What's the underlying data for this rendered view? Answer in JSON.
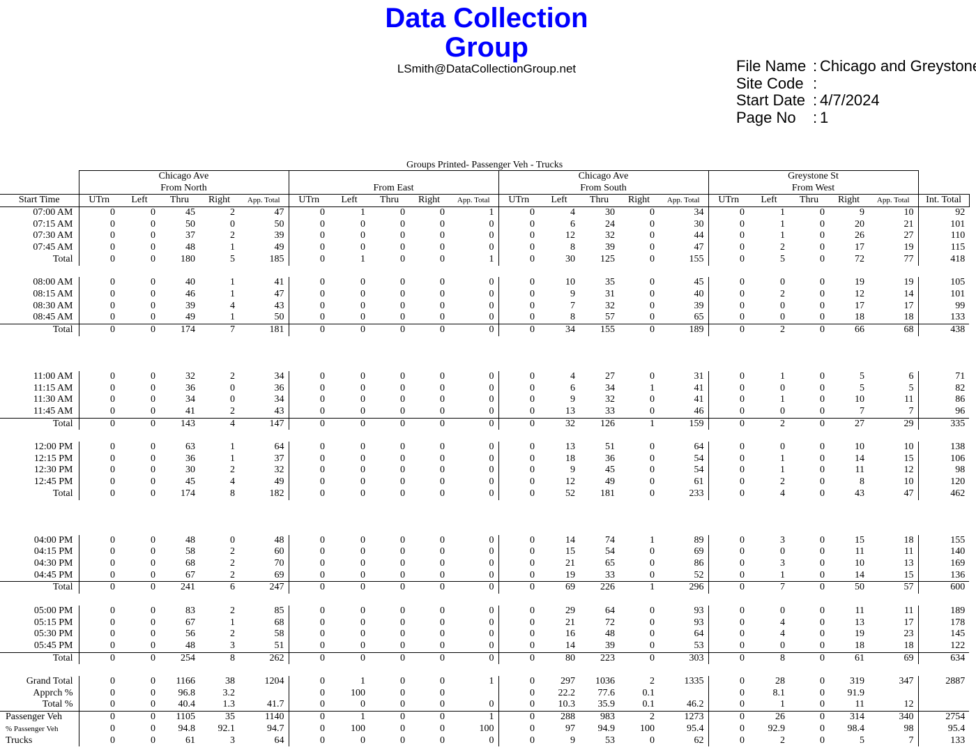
{
  "header": {
    "title": "Data Collection Group",
    "email": "LSmith@DataCollectionGroup.net"
  },
  "meta": [
    {
      "label": "File Name",
      "value": "Chicago and Greystone"
    },
    {
      "label": "Site Code",
      "value": ""
    },
    {
      "label": "Start Date",
      "value": "4/7/2024"
    },
    {
      "label": "Page No",
      "value": "1"
    }
  ],
  "table": {
    "caption": "Groups Printed- Passenger Veh - Trucks",
    "groups": [
      {
        "street": "Chicago Ave",
        "dir": "From North"
      },
      {
        "street": "",
        "dir": "From East"
      },
      {
        "street": "Chicago Ave",
        "dir": "From South"
      },
      {
        "street": "Greystone St",
        "dir": "From West"
      }
    ],
    "columns": [
      "Start Time",
      "UTrn",
      "Left",
      "Thru",
      "Right",
      "App. Total",
      "UTrn",
      "Left",
      "Thru",
      "Right",
      "App. Total",
      "UTrn",
      "Left",
      "Thru",
      "Right",
      "App. Total",
      "UTrn",
      "Left",
      "Thru",
      "Right",
      "App. Total",
      "Int. Total"
    ],
    "rows": [
      {
        "kind": "data",
        "cells": [
          "07:00 AM",
          "0",
          "0",
          "45",
          "2",
          "47",
          "0",
          "1",
          "0",
          "0",
          "1",
          "0",
          "4",
          "30",
          "0",
          "34",
          "0",
          "1",
          "0",
          "9",
          "10",
          "92"
        ]
      },
      {
        "kind": "data",
        "cells": [
          "07:15 AM",
          "0",
          "0",
          "50",
          "0",
          "50",
          "0",
          "0",
          "0",
          "0",
          "0",
          "0",
          "6",
          "24",
          "0",
          "30",
          "0",
          "1",
          "0",
          "20",
          "21",
          "101"
        ]
      },
      {
        "kind": "data",
        "cells": [
          "07:30 AM",
          "0",
          "0",
          "37",
          "2",
          "39",
          "0",
          "0",
          "0",
          "0",
          "0",
          "0",
          "12",
          "32",
          "0",
          "44",
          "0",
          "1",
          "0",
          "26",
          "27",
          "110"
        ]
      },
      {
        "kind": "data",
        "cells": [
          "07:45 AM",
          "0",
          "0",
          "48",
          "1",
          "49",
          "0",
          "0",
          "0",
          "0",
          "0",
          "0",
          "8",
          "39",
          "0",
          "47",
          "0",
          "2",
          "0",
          "17",
          "19",
          "115"
        ]
      },
      {
        "kind": "total",
        "cells": [
          "Total",
          "0",
          "0",
          "180",
          "5",
          "185",
          "0",
          "1",
          "0",
          "0",
          "1",
          "0",
          "30",
          "125",
          "0",
          "155",
          "0",
          "5",
          "0",
          "72",
          "77",
          "418"
        ]
      },
      {
        "kind": "blank"
      },
      {
        "kind": "data",
        "cells": [
          "08:00 AM",
          "0",
          "0",
          "40",
          "1",
          "41",
          "0",
          "0",
          "0",
          "0",
          "0",
          "0",
          "10",
          "35",
          "0",
          "45",
          "0",
          "0",
          "0",
          "19",
          "19",
          "105"
        ]
      },
      {
        "kind": "data",
        "cells": [
          "08:15 AM",
          "0",
          "0",
          "46",
          "1",
          "47",
          "0",
          "0",
          "0",
          "0",
          "0",
          "0",
          "9",
          "31",
          "0",
          "40",
          "0",
          "2",
          "0",
          "12",
          "14",
          "101"
        ]
      },
      {
        "kind": "data",
        "cells": [
          "08:30 AM",
          "0",
          "0",
          "39",
          "4",
          "43",
          "0",
          "0",
          "0",
          "0",
          "0",
          "0",
          "7",
          "32",
          "0",
          "39",
          "0",
          "0",
          "0",
          "17",
          "17",
          "99"
        ]
      },
      {
        "kind": "data",
        "cells": [
          "08:45 AM",
          "0",
          "0",
          "49",
          "1",
          "50",
          "0",
          "0",
          "0",
          "0",
          "0",
          "0",
          "8",
          "57",
          "0",
          "65",
          "0",
          "0",
          "0",
          "18",
          "18",
          "133"
        ]
      },
      {
        "kind": "total",
        "cells": [
          "Total",
          "0",
          "0",
          "174",
          "7",
          "181",
          "0",
          "0",
          "0",
          "0",
          "0",
          "0",
          "34",
          "155",
          "0",
          "189",
          "0",
          "2",
          "0",
          "66",
          "68",
          "438"
        ]
      },
      {
        "kind": "blank"
      },
      {
        "kind": "blank"
      },
      {
        "kind": "blank"
      },
      {
        "kind": "data",
        "cells": [
          "11:00 AM",
          "0",
          "0",
          "32",
          "2",
          "34",
          "0",
          "0",
          "0",
          "0",
          "0",
          "0",
          "4",
          "27",
          "0",
          "31",
          "0",
          "1",
          "0",
          "5",
          "6",
          "71"
        ]
      },
      {
        "kind": "data",
        "cells": [
          "11:15 AM",
          "0",
          "0",
          "36",
          "0",
          "36",
          "0",
          "0",
          "0",
          "0",
          "0",
          "0",
          "6",
          "34",
          "1",
          "41",
          "0",
          "0",
          "0",
          "5",
          "5",
          "82"
        ]
      },
      {
        "kind": "data",
        "cells": [
          "11:30 AM",
          "0",
          "0",
          "34",
          "0",
          "34",
          "0",
          "0",
          "0",
          "0",
          "0",
          "0",
          "9",
          "32",
          "0",
          "41",
          "0",
          "1",
          "0",
          "10",
          "11",
          "86"
        ]
      },
      {
        "kind": "data",
        "cells": [
          "11:45 AM",
          "0",
          "0",
          "41",
          "2",
          "43",
          "0",
          "0",
          "0",
          "0",
          "0",
          "0",
          "13",
          "33",
          "0",
          "46",
          "0",
          "0",
          "0",
          "7",
          "7",
          "96"
        ]
      },
      {
        "kind": "total",
        "cells": [
          "Total",
          "0",
          "0",
          "143",
          "4",
          "147",
          "0",
          "0",
          "0",
          "0",
          "0",
          "0",
          "32",
          "126",
          "1",
          "159",
          "0",
          "2",
          "0",
          "27",
          "29",
          "335"
        ]
      },
      {
        "kind": "blank"
      },
      {
        "kind": "data",
        "cells": [
          "12:00 PM",
          "0",
          "0",
          "63",
          "1",
          "64",
          "0",
          "0",
          "0",
          "0",
          "0",
          "0",
          "13",
          "51",
          "0",
          "64",
          "0",
          "0",
          "0",
          "10",
          "10",
          "138"
        ]
      },
      {
        "kind": "data",
        "cells": [
          "12:15 PM",
          "0",
          "0",
          "36",
          "1",
          "37",
          "0",
          "0",
          "0",
          "0",
          "0",
          "0",
          "18",
          "36",
          "0",
          "54",
          "0",
          "1",
          "0",
          "14",
          "15",
          "106"
        ]
      },
      {
        "kind": "data",
        "cells": [
          "12:30 PM",
          "0",
          "0",
          "30",
          "2",
          "32",
          "0",
          "0",
          "0",
          "0",
          "0",
          "0",
          "9",
          "45",
          "0",
          "54",
          "0",
          "1",
          "0",
          "11",
          "12",
          "98"
        ]
      },
      {
        "kind": "data",
        "cells": [
          "12:45 PM",
          "0",
          "0",
          "45",
          "4",
          "49",
          "0",
          "0",
          "0",
          "0",
          "0",
          "0",
          "12",
          "49",
          "0",
          "61",
          "0",
          "2",
          "0",
          "8",
          "10",
          "120"
        ]
      },
      {
        "kind": "total",
        "cells": [
          "Total",
          "0",
          "0",
          "174",
          "8",
          "182",
          "0",
          "0",
          "0",
          "0",
          "0",
          "0",
          "52",
          "181",
          "0",
          "233",
          "0",
          "4",
          "0",
          "43",
          "47",
          "462"
        ]
      },
      {
        "kind": "blank"
      },
      {
        "kind": "blank"
      },
      {
        "kind": "blank"
      },
      {
        "kind": "data",
        "cells": [
          "04:00 PM",
          "0",
          "0",
          "48",
          "0",
          "48",
          "0",
          "0",
          "0",
          "0",
          "0",
          "0",
          "14",
          "74",
          "1",
          "89",
          "0",
          "3",
          "0",
          "15",
          "18",
          "155"
        ]
      },
      {
        "kind": "data",
        "cells": [
          "04:15 PM",
          "0",
          "0",
          "58",
          "2",
          "60",
          "0",
          "0",
          "0",
          "0",
          "0",
          "0",
          "15",
          "54",
          "0",
          "69",
          "0",
          "0",
          "0",
          "11",
          "11",
          "140"
        ]
      },
      {
        "kind": "data",
        "cells": [
          "04:30 PM",
          "0",
          "0",
          "68",
          "2",
          "70",
          "0",
          "0",
          "0",
          "0",
          "0",
          "0",
          "21",
          "65",
          "0",
          "86",
          "0",
          "3",
          "0",
          "10",
          "13",
          "169"
        ]
      },
      {
        "kind": "data",
        "cells": [
          "04:45 PM",
          "0",
          "0",
          "67",
          "2",
          "69",
          "0",
          "0",
          "0",
          "0",
          "0",
          "0",
          "19",
          "33",
          "0",
          "52",
          "0",
          "1",
          "0",
          "14",
          "15",
          "136"
        ]
      },
      {
        "kind": "total",
        "cells": [
          "Total",
          "0",
          "0",
          "241",
          "6",
          "247",
          "0",
          "0",
          "0",
          "0",
          "0",
          "0",
          "69",
          "226",
          "1",
          "296",
          "0",
          "7",
          "0",
          "50",
          "57",
          "600"
        ]
      },
      {
        "kind": "blank"
      },
      {
        "kind": "data",
        "cells": [
          "05:00 PM",
          "0",
          "0",
          "83",
          "2",
          "85",
          "0",
          "0",
          "0",
          "0",
          "0",
          "0",
          "29",
          "64",
          "0",
          "93",
          "0",
          "0",
          "0",
          "11",
          "11",
          "189"
        ]
      },
      {
        "kind": "data",
        "cells": [
          "05:15 PM",
          "0",
          "0",
          "67",
          "1",
          "68",
          "0",
          "0",
          "0",
          "0",
          "0",
          "0",
          "21",
          "72",
          "0",
          "93",
          "0",
          "4",
          "0",
          "13",
          "17",
          "178"
        ]
      },
      {
        "kind": "data",
        "cells": [
          "05:30 PM",
          "0",
          "0",
          "56",
          "2",
          "58",
          "0",
          "0",
          "0",
          "0",
          "0",
          "0",
          "16",
          "48",
          "0",
          "64",
          "0",
          "4",
          "0",
          "19",
          "23",
          "145"
        ]
      },
      {
        "kind": "data",
        "cells": [
          "05:45 PM",
          "0",
          "0",
          "48",
          "3",
          "51",
          "0",
          "0",
          "0",
          "0",
          "0",
          "0",
          "14",
          "39",
          "0",
          "53",
          "0",
          "0",
          "0",
          "18",
          "18",
          "122"
        ]
      },
      {
        "kind": "total",
        "cells": [
          "Total",
          "0",
          "0",
          "254",
          "8",
          "262",
          "0",
          "0",
          "0",
          "0",
          "0",
          "0",
          "80",
          "223",
          "0",
          "303",
          "0",
          "8",
          "0",
          "61",
          "69",
          "634"
        ]
      },
      {
        "kind": "blank"
      },
      {
        "kind": "summary",
        "cells": [
          "Grand Total",
          "0",
          "0",
          "1166",
          "38",
          "1204",
          "0",
          "1",
          "0",
          "0",
          "1",
          "0",
          "297",
          "1036",
          "2",
          "1335",
          "0",
          "28",
          "0",
          "319",
          "347",
          "2887"
        ]
      },
      {
        "kind": "summary",
        "cells": [
          "Apprch %",
          "0",
          "0",
          "96.8",
          "3.2",
          "",
          "0",
          "100",
          "0",
          "0",
          "",
          "0",
          "22.2",
          "77.6",
          "0.1",
          "",
          "0",
          "8.1",
          "0",
          "91.9",
          "",
          ""
        ]
      },
      {
        "kind": "summary",
        "cells": [
          "Total %",
          "0",
          "0",
          "40.4",
          "1.3",
          "41.7",
          "0",
          "0",
          "0",
          "0",
          "0",
          "0",
          "10.3",
          "35.9",
          "0.1",
          "46.2",
          "0",
          "1",
          "0",
          "11",
          "12",
          ""
        ]
      },
      {
        "kind": "summary2",
        "cells": [
          "Passenger Veh",
          "0",
          "0",
          "1105",
          "35",
          "1140",
          "0",
          "1",
          "0",
          "0",
          "1",
          "0",
          "288",
          "983",
          "2",
          "1273",
          "0",
          "26",
          "0",
          "314",
          "340",
          "2754"
        ]
      },
      {
        "kind": "summary2",
        "cells": [
          "% Passenger Veh",
          "0",
          "0",
          "94.8",
          "92.1",
          "94.7",
          "0",
          "100",
          "0",
          "0",
          "100",
          "0",
          "97",
          "94.9",
          "100",
          "95.4",
          "0",
          "92.9",
          "0",
          "98.4",
          "98",
          "95.4"
        ]
      },
      {
        "kind": "summary2",
        "cells": [
          "Trucks",
          "0",
          "0",
          "61",
          "3",
          "64",
          "0",
          "0",
          "0",
          "0",
          "0",
          "0",
          "9",
          "53",
          "0",
          "62",
          "0",
          "2",
          "0",
          "5",
          "7",
          "133"
        ]
      }
    ]
  }
}
